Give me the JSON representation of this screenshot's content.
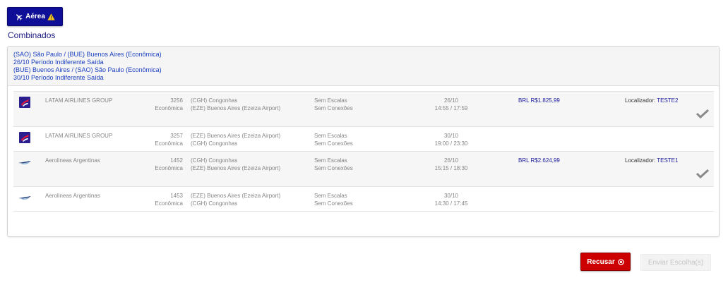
{
  "tab": {
    "label": "Aérea",
    "icon": "airplane-icon",
    "warning_icon": "warning-icon"
  },
  "section": {
    "title": "Combinados"
  },
  "summary": {
    "lines": [
      "(SAO) São Paulo / (BUE) Buenos Aires (Econômica)",
      "26/10 Período Indiferente Saída",
      "(BUE) Buenos Aires / (SAO) São Paulo (Econômica)",
      "30/10 Período Indiferente Saída"
    ]
  },
  "options": [
    {
      "price": "BRL R$1.825,99",
      "locator_label": "Localizador:",
      "locator": "TESTE2",
      "selected": true,
      "flights": [
        {
          "airline": "LATAM AIRLINES GROUP",
          "logo": "latam-logo",
          "flight_no": "3256",
          "cabin": "Econômica",
          "origin": "(CGH) Congonhas",
          "destination": "(EZE) Buenos Aires (Ezeiza Airport)",
          "stops": "Sem Escalas",
          "connections": "Sem Conexões",
          "date": "26/10",
          "times": "14:55 / 17:59"
        },
        {
          "airline": "LATAM AIRLINES GROUP",
          "logo": "latam-logo",
          "flight_no": "3257",
          "cabin": "Econômica",
          "origin": "(EZE) Buenos Aires (Ezeiza Airport)",
          "destination": "(CGH) Congonhas",
          "stops": "Sem Escalas",
          "connections": "Sem Conexões",
          "date": "30/10",
          "times": "19:00 / 23:30"
        }
      ]
    },
    {
      "price": "BRL R$2.624,99",
      "locator_label": "Localizador:",
      "locator": "TESTE1",
      "selected": true,
      "flights": [
        {
          "airline": "Aerolineas Argentinas",
          "logo": "aerolineas-logo",
          "flight_no": "1452",
          "cabin": "Econômica",
          "origin": "(CGH) Congonhas",
          "destination": "(EZE) Buenos Aires (Ezeiza Airport)",
          "stops": "Sem Escalas",
          "connections": "Sem Conexões",
          "date": "26/10",
          "times": "15:15 / 18:30"
        },
        {
          "airline": "Aerolineas Argentinas",
          "logo": "aerolineas-logo",
          "flight_no": "1453",
          "cabin": "Econômica",
          "origin": "(EZE) Buenos Aires (Ezeiza Airport)",
          "destination": "(CGH) Congonhas",
          "stops": "Sem Escalas",
          "connections": "Sem Conexões",
          "date": "30/10",
          "times": "14:30 / 17:45"
        }
      ]
    }
  ],
  "actions": {
    "refuse_label": "Recusar",
    "send_label": "Enviar Escolha(s)"
  },
  "colors": {
    "primary": "#0f0e96",
    "danger": "#cc0000",
    "link": "#1a3fbf"
  }
}
